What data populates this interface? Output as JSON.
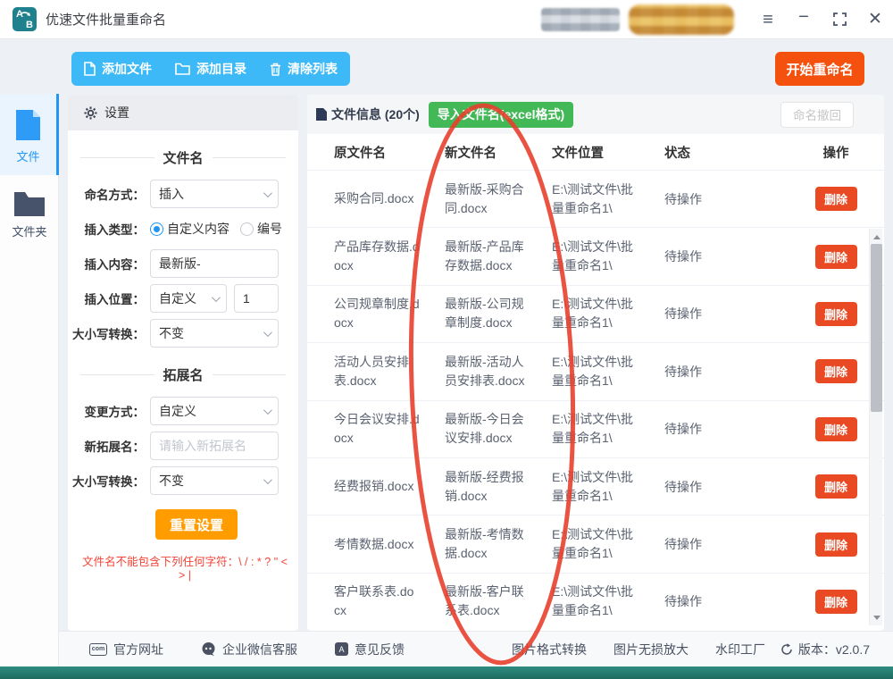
{
  "window": {
    "title": "优速文件批量重命名",
    "icon_letter_a": "A",
    "icon_letter_b": "B",
    "menu_glyph": "≡",
    "minimize_glyph": "−",
    "close_glyph": "✕"
  },
  "toolbar": {
    "add_file": "添加文件",
    "add_dir": "添加目录",
    "clear_list": "清除列表",
    "start_rename": "开始重命名"
  },
  "sidebar": {
    "items": [
      {
        "label": "文件",
        "active": true
      },
      {
        "label": "文件夹",
        "active": false
      }
    ]
  },
  "settings": {
    "header": "设置",
    "section_filename": "文件名",
    "naming_label": "命名方式：",
    "naming_value": "插入",
    "insert_type_label": "插入类型：",
    "insert_type_custom": "自定义内容",
    "insert_type_number": "编号",
    "insert_content_label": "插入内容：",
    "insert_content_value": "最新版-",
    "insert_pos_label": "插入位置：",
    "insert_pos_value": "自定义",
    "insert_pos_number": "1",
    "case_label": "大小写转换：",
    "case_value": "不变",
    "section_ext": "拓展名",
    "change_label": "变更方式：",
    "change_value": "自定义",
    "new_ext_label": "新拓展名：",
    "new_ext_placeholder": "请输入新拓展名",
    "ext_case_label": "大小写转换：",
    "ext_case_value": "不变",
    "reset_button": "重置设置",
    "warning": "文件名不能包含下列任何字符：\\ / : * ? \" < > |"
  },
  "filepanel": {
    "info_label": "文件信息 (20个)",
    "import_button": "导入文件名(excel格式)",
    "undo_button": "命名撤回",
    "columns": [
      "原文件名",
      "新文件名",
      "文件位置",
      "状态",
      "操作"
    ],
    "delete_label": "删除",
    "rows": [
      {
        "old": "采购合同.docx",
        "new": "最新版-采购合同.docx",
        "path": "E:\\测试文件\\批量重命名1\\",
        "status": "待操作"
      },
      {
        "old": "产品库存数据.docx",
        "new": "最新版-产品库存数据.docx",
        "path": "E:\\测试文件\\批量重命名1\\",
        "status": "待操作"
      },
      {
        "old": "公司规章制度.docx",
        "new": "最新版-公司规章制度.docx",
        "path": "E:\\测试文件\\批量重命名1\\",
        "status": "待操作"
      },
      {
        "old": "活动人员安排表.docx",
        "new": "最新版-活动人员安排表.docx",
        "path": "E:\\测试文件\\批量重命名1\\",
        "status": "待操作"
      },
      {
        "old": "今日会议安排.docx",
        "new": "最新版-今日会议安排.docx",
        "path": "E:\\测试文件\\批量重命名1\\",
        "status": "待操作"
      },
      {
        "old": "经费报销.docx",
        "new": "最新版-经费报销.docx",
        "path": "E:\\测试文件\\批量重命名1\\",
        "status": "待操作"
      },
      {
        "old": "考情数据.docx",
        "new": "最新版-考情数据.docx",
        "path": "E:\\测试文件\\批量重命名1\\",
        "status": "待操作"
      },
      {
        "old": "客户联系表.docx",
        "new": "最新版-客户联系表.docx",
        "path": "E:\\测试文件\\批量重命名1\\",
        "status": "待操作"
      }
    ]
  },
  "footer": {
    "official_site": "官方网址",
    "wechat_service": "企业微信客服",
    "feedback": "意见反馈",
    "img_convert": "图片格式转换",
    "img_enlarge": "图片无损放大",
    "watermark": "水印工厂",
    "version": "版本：v2.0.7"
  },
  "colors": {
    "toolbar_blue": "#3cb9f6",
    "start_orange": "#f4500e",
    "import_green": "#43b857",
    "delete_red": "#ea4a23",
    "reset_orange": "#ff9c00",
    "accent_blue": "#2196f3",
    "annotation_red": "#e8402e",
    "app_icon_teal": "#1f808e"
  }
}
